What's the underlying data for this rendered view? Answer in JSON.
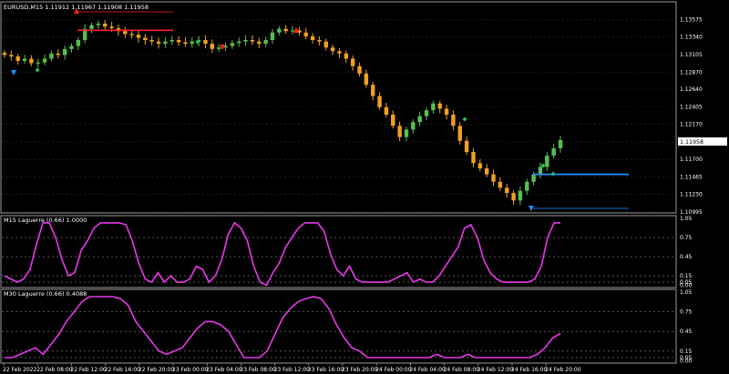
{
  "window": {
    "symbol_title": "EURUSD,M15  1.11912 1.11967 1.11908 1.11958",
    "current_price": "1.11958"
  },
  "colors": {
    "background": "#000000",
    "grid": "#2e2e2e",
    "frame": "#9a9a9a",
    "bull_candle": "#55c050",
    "bear_candle": "#f0a020",
    "indicator_line": "#e838e8",
    "level_red": "#ff2020",
    "level_blue": "#1e90ff",
    "signal_green": "#28c060"
  },
  "main_panel": {
    "price_labels": [
      "1.13575",
      "1.13340",
      "1.13105",
      "1.12870",
      "1.12640",
      "1.12405",
      "1.12170",
      "1.11935",
      "1.11700",
      "1.11465",
      "1.11230",
      "1.10995"
    ],
    "red_level_price": 1.1343,
    "blue_level_price": 1.115
  },
  "indicator_panels": [
    {
      "title": "M15 Laguerre (0.66) 1.0000",
      "levels": [
        "1.05",
        "0.75",
        "0.45",
        "0.15",
        "0.05",
        "0.00"
      ],
      "values": [
        0.15,
        0.1,
        0.05,
        0.1,
        0.25,
        0.65,
        0.98,
        0.98,
        0.75,
        0.4,
        0.15,
        0.2,
        0.55,
        0.7,
        0.9,
        0.98,
        0.98,
        0.98,
        0.98,
        0.95,
        0.7,
        0.35,
        0.1,
        0.05,
        0.2,
        0.05,
        0.15,
        0.05,
        0.05,
        0.1,
        0.3,
        0.25,
        0.05,
        0.15,
        0.4,
        0.8,
        0.98,
        0.9,
        0.7,
        0.3,
        0.05,
        0.0,
        0.2,
        0.35,
        0.6,
        0.75,
        0.9,
        0.98,
        0.98,
        0.98,
        0.85,
        0.5,
        0.25,
        0.15,
        0.3,
        0.1,
        0.05,
        0.05,
        0.05,
        0.05,
        0.05,
        0.1,
        0.15,
        0.2,
        0.05,
        0.1,
        0.05,
        0.05,
        0.15,
        0.3,
        0.45,
        0.6,
        0.9,
        0.95,
        0.75,
        0.4,
        0.2,
        0.1,
        0.05,
        0.05,
        0.05,
        0.05,
        0.05,
        0.1,
        0.3,
        0.75,
        0.98,
        0.98
      ]
    },
    {
      "title": "M30 Laguerre (0.66) 0.4088",
      "levels": [
        "1.05",
        "0.75",
        "0.45",
        "0.15",
        "0.05",
        "0.00"
      ],
      "values": [
        0.05,
        0.05,
        0.1,
        0.15,
        0.2,
        0.1,
        0.25,
        0.4,
        0.6,
        0.75,
        0.9,
        0.98,
        0.98,
        0.98,
        0.98,
        0.95,
        0.85,
        0.6,
        0.45,
        0.3,
        0.15,
        0.1,
        0.15,
        0.2,
        0.35,
        0.5,
        0.6,
        0.6,
        0.55,
        0.45,
        0.25,
        0.05,
        0.05,
        0.05,
        0.15,
        0.4,
        0.65,
        0.8,
        0.9,
        0.95,
        0.98,
        0.95,
        0.8,
        0.55,
        0.35,
        0.2,
        0.15,
        0.05,
        0.05,
        0.05,
        0.05,
        0.05,
        0.05,
        0.05,
        0.05,
        0.05,
        0.1,
        0.05,
        0.05,
        0.05,
        0.1,
        0.05,
        0.05,
        0.05,
        0.05,
        0.05,
        0.05,
        0.05,
        0.05,
        0.1,
        0.2,
        0.35,
        0.42
      ]
    }
  ],
  "time_axis": {
    "labels": [
      "22 Feb 2022",
      "22 Feb 08:00",
      "22 Feb 12:00",
      "22 Feb 16:00",
      "22 Feb 20:00",
      "23 Feb 00:00",
      "23 Feb 04:00",
      "23 Feb 08:00",
      "23 Feb 12:00",
      "23 Feb 16:00",
      "23 Feb 20:00",
      "24 Feb 00:00",
      "24 Feb 04:00",
      "24 Feb 08:00",
      "24 Feb 12:00",
      "24 Feb 16:00",
      "24 Feb 20:00"
    ]
  },
  "chart_data": {
    "type": "candlestick",
    "title": "EURUSD,M15  1.11912 1.11967 1.11908 1.11958",
    "ylim": [
      1.10995,
      1.138
    ],
    "close": [
      1.131,
      1.1308,
      1.1302,
      1.1305,
      1.1299,
      1.13,
      1.1305,
      1.1312,
      1.131,
      1.1318,
      1.1322,
      1.133,
      1.1345,
      1.135,
      1.1352,
      1.1348,
      1.1346,
      1.1342,
      1.1338,
      1.1337,
      1.1333,
      1.133,
      1.1328,
      1.1325,
      1.1328,
      1.133,
      1.1327,
      1.1325,
      1.1328,
      1.133,
      1.1325,
      1.1318,
      1.132,
      1.1322,
      1.1326,
      1.1328,
      1.133,
      1.1328,
      1.1325,
      1.133,
      1.134,
      1.1345,
      1.1342,
      1.1343,
      1.134,
      1.1335,
      1.133,
      1.1328,
      1.132,
      1.1315,
      1.1312,
      1.1305,
      1.1295,
      1.1285,
      1.127,
      1.1255,
      1.124,
      1.123,
      1.1215,
      1.12,
      1.121,
      1.122,
      1.1228,
      1.1236,
      1.1245,
      1.1238,
      1.123,
      1.1215,
      1.1195,
      1.118,
      1.1165,
      1.1158,
      1.115,
      1.114,
      1.1132,
      1.1125,
      1.1115,
      1.1128,
      1.114,
      1.115,
      1.116,
      1.1175,
      1.1185,
      1.1196
    ]
  }
}
